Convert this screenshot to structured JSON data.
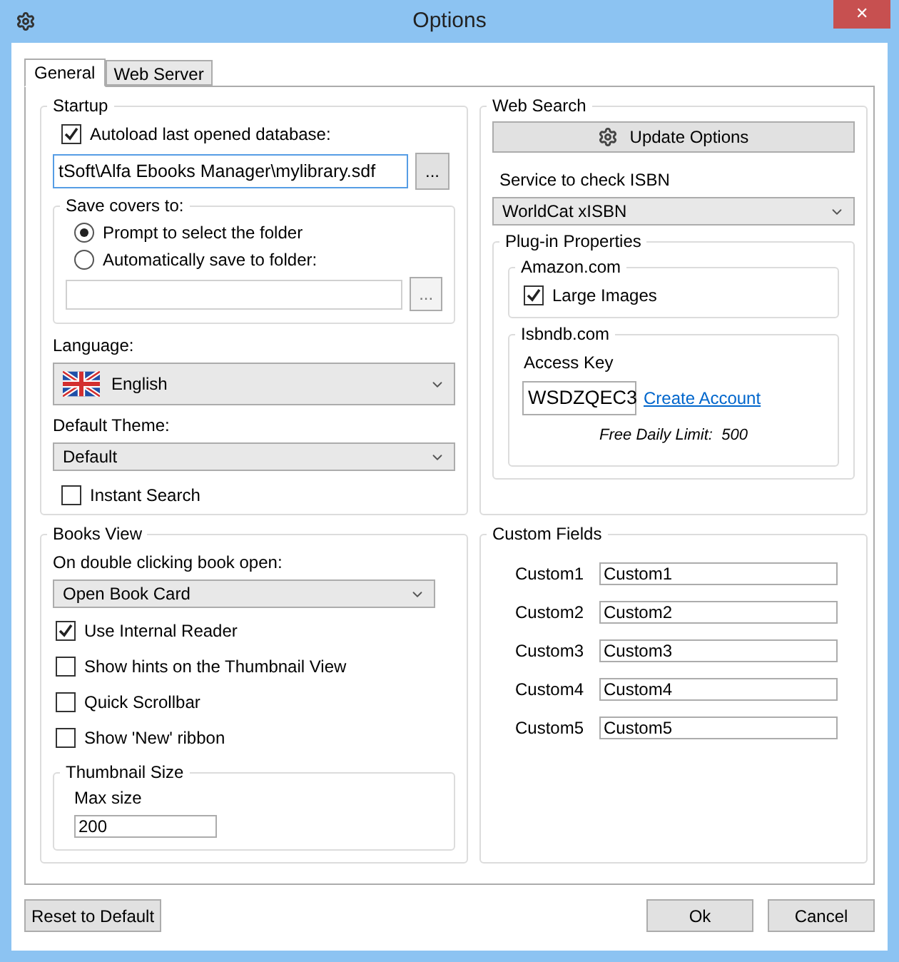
{
  "window": {
    "title": "Options",
    "close": "✕"
  },
  "tabs": [
    {
      "label": "General",
      "selected": true
    },
    {
      "label": "Web Server",
      "selected": false
    }
  ],
  "startup": {
    "title": "Startup",
    "autoload": {
      "label": "Autoload last opened database:",
      "checked": true
    },
    "database_path": "tSoft\\Alfa Ebooks Manager\\mylibrary.sdf",
    "database_browse": "...",
    "save_covers": {
      "title": "Save covers to:",
      "options": [
        {
          "label": "Prompt to select the folder",
          "selected": true
        },
        {
          "label": "Automatically save to folder:",
          "selected": false
        }
      ],
      "browse": "..."
    },
    "language": {
      "label": "Language:",
      "value": "English"
    },
    "theme": {
      "label": "Default Theme:",
      "value": "Default"
    },
    "instant_search": {
      "label": "Instant Search",
      "checked": false
    }
  },
  "web_search": {
    "title": "Web Search",
    "update_button": "Update Options",
    "service_label": "Service to check ISBN",
    "service": "WorldCat xISBN",
    "plugin": {
      "title": "Plug-in Properties",
      "amazon": {
        "title": "Amazon.com",
        "large_images": {
          "label": "Large Images",
          "checked": true
        }
      },
      "isbndb": {
        "title": "Isbndb.com",
        "key_label": "Access Key",
        "key": "WSDZQEC3",
        "link": "Create Account",
        "limit": "Free Daily Limit:  500"
      }
    }
  },
  "books_view": {
    "title": "Books View",
    "open_label": "On double clicking book open:",
    "open_value": "Open Book Card",
    "options": [
      {
        "label": "Use Internal Reader",
        "checked": true
      },
      {
        "label": "Show hints on the Thumbnail View",
        "checked": false
      },
      {
        "label": "Quick Scrollbar",
        "checked": false
      },
      {
        "label": "Show 'New' ribbon",
        "checked": false
      }
    ],
    "thumbnail": {
      "title": "Thumbnail Size",
      "label": "Max size",
      "value": "200"
    }
  },
  "custom_fields": {
    "title": "Custom Fields",
    "fields": [
      {
        "label": "Custom1",
        "value": "Custom1"
      },
      {
        "label": "Custom2",
        "value": "Custom2"
      },
      {
        "label": "Custom3",
        "value": "Custom3"
      },
      {
        "label": "Custom4",
        "value": "Custom4"
      },
      {
        "label": "Custom5",
        "value": "Custom5"
      }
    ]
  },
  "buttons": {
    "reset": "Reset to Default",
    "ok": "Ok",
    "cancel": "Cancel"
  }
}
